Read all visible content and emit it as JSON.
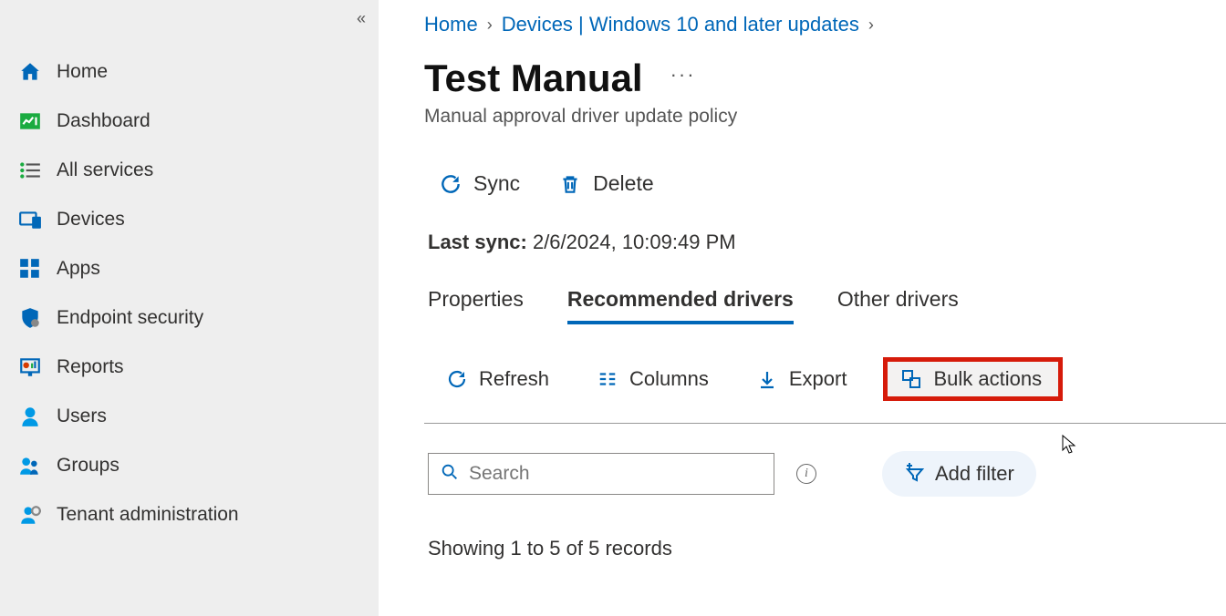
{
  "sidebar": {
    "items": [
      {
        "label": "Home"
      },
      {
        "label": "Dashboard"
      },
      {
        "label": "All services"
      },
      {
        "label": "Devices"
      },
      {
        "label": "Apps"
      },
      {
        "label": "Endpoint security"
      },
      {
        "label": "Reports"
      },
      {
        "label": "Users"
      },
      {
        "label": "Groups"
      },
      {
        "label": "Tenant administration"
      }
    ]
  },
  "breadcrumb": {
    "home": "Home",
    "devices": "Devices | Windows 10 and later updates"
  },
  "page": {
    "title": "Test Manual",
    "subtitle": "Manual approval driver update policy"
  },
  "commands": {
    "sync": "Sync",
    "delete": "Delete"
  },
  "last_sync": {
    "label": "Last sync:",
    "value": "2/6/2024, 10:09:49 PM"
  },
  "tabs": {
    "properties": "Properties",
    "recommended": "Recommended drivers",
    "other": "Other drivers"
  },
  "toolbar": {
    "refresh": "Refresh",
    "columns": "Columns",
    "export": "Export",
    "bulk": "Bulk actions"
  },
  "search": {
    "placeholder": "Search"
  },
  "filter": {
    "add": "Add filter"
  },
  "records": "Showing 1 to 5 of 5 records"
}
